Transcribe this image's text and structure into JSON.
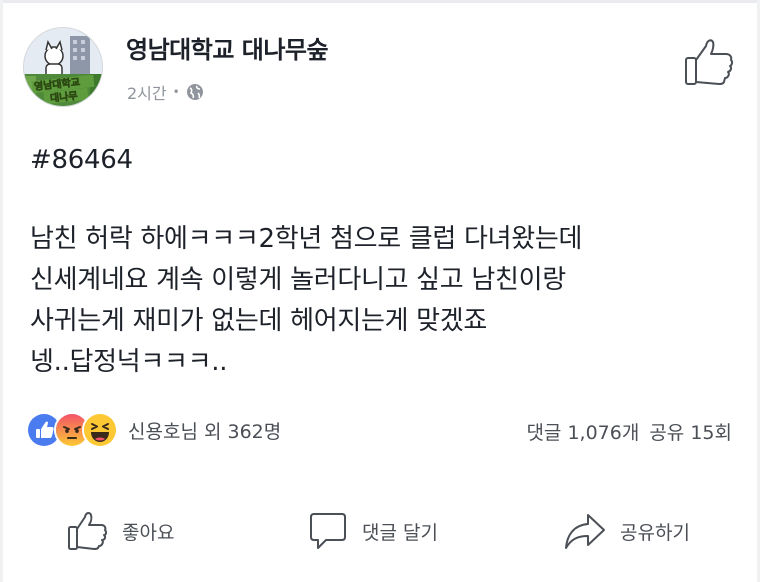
{
  "header": {
    "page_name": "영남대학교 대나무숲",
    "time": "2시간",
    "separator": "•",
    "audience_icon": "globe-icon",
    "avatar_label": "영남대학교 대나무숲",
    "like_page_icon": "thumbs-up-outline-icon"
  },
  "post": {
    "hashtag": "#86464",
    "lines": [
      "남친 허락 하에ㅋㅋㅋ2학년 첨으로 클럽 다녀왔는데",
      "신세계네요 계속 이렇게 놀러다니고 싶고 남친이랑",
      "사귀는게 재미가 없는데 헤어지는게 맞겠죠",
      "넹..답정넉ㅋㅋㅋ.."
    ]
  },
  "reactions": {
    "icons": [
      "like-reaction-icon",
      "angry-reaction-icon",
      "haha-reaction-icon"
    ],
    "summary": "신용호님 외 362명"
  },
  "stats": {
    "comments": "댓글 1,076개",
    "shares": "공유 15회"
  },
  "actions": {
    "like": "좋아요",
    "comment": "댓글 달기",
    "share": "공유하기"
  },
  "colors": {
    "like_blue": "#4267b2",
    "angry_red": "#f25268",
    "haha_yellow": "#fcc934",
    "secondary_text": "#90949c",
    "body_text": "#1d2129"
  }
}
